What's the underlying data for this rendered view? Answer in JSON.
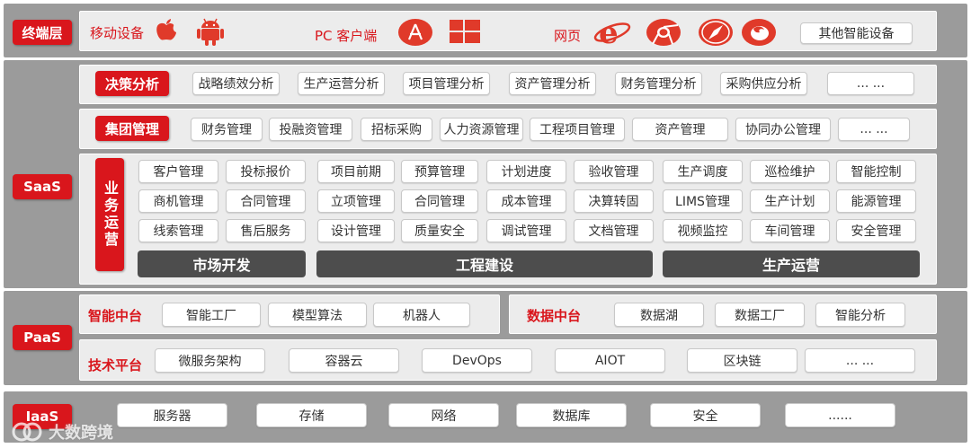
{
  "layers": {
    "terminal": "终端层",
    "saas": "SaaS",
    "paas": "PaaS",
    "iaas": "IaaS"
  },
  "terminal": {
    "mobile_label": "移动设备",
    "pc_label": "PC 客户端",
    "web_label": "网页",
    "other_label": "其他智能设备"
  },
  "saas": {
    "decision": {
      "tag": "决策分析",
      "items": [
        "战略绩效分析",
        "生产运营分析",
        "项目管理分析",
        "资产管理分析",
        "财务管理分析",
        "采购供应分析",
        "... ..."
      ]
    },
    "group": {
      "tag": "集团管理",
      "items": [
        "财务管理",
        "投融资管理",
        "招标采购",
        "人力资源管理",
        "工程项目管理",
        "资产管理",
        "协同办公管理",
        "... ..."
      ]
    },
    "ops": {
      "tag": "业务运营",
      "grid": [
        [
          "客户管理",
          "投标报价",
          "项目前期",
          "预算管理",
          "计划进度",
          "验收管理",
          "生产调度",
          "巡检维护",
          "智能控制"
        ],
        [
          "商机管理",
          "合同管理",
          "立项管理",
          "合同管理",
          "成本管理",
          "决算转固",
          "LIMS管理",
          "生产计划",
          "能源管理"
        ],
        [
          "线索管理",
          "售后服务",
          "设计管理",
          "质量安全",
          "调试管理",
          "文档管理",
          "视频监控",
          "车间管理",
          "安全管理"
        ]
      ],
      "sections": [
        "市场开发",
        "工程建设",
        "生产运营"
      ]
    }
  },
  "paas": {
    "smart_mid": {
      "title": "智能中台",
      "items": [
        "智能工厂",
        "模型算法",
        "机器人"
      ]
    },
    "data_mid": {
      "title": "数据中台",
      "items": [
        "数据湖",
        "数据工厂",
        "智能分析"
      ]
    },
    "tech": {
      "title": "技术平台",
      "items": [
        "微服务架构",
        "容器云",
        "DevOps",
        "AIOT",
        "区块链",
        "... ..."
      ]
    }
  },
  "iaas": {
    "items": [
      "服务器",
      "存储",
      "网络",
      "数据库",
      "安全",
      "......"
    ]
  },
  "watermark": "大数跨境",
  "colors": {
    "accent": "#d9161c",
    "band": "#9b9b9b",
    "panel": "#ececec",
    "dark": "#4d4d4d"
  }
}
